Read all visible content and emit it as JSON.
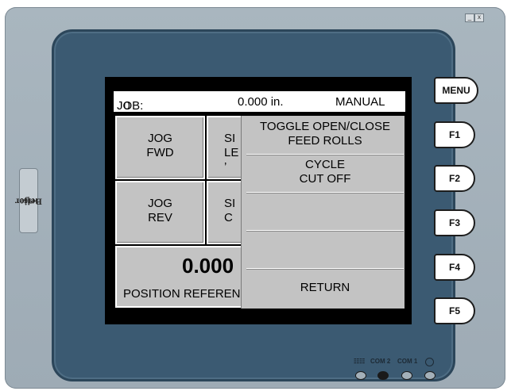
{
  "window_controls": {
    "minimize": "_",
    "close": "x"
  },
  "brand": {
    "model": "HT60",
    "separator": "|",
    "name": "Beijer"
  },
  "status": {
    "job_label": "JOB:",
    "job_value": "0",
    "position": "0.000 in.",
    "mode": "MANUAL"
  },
  "tiles": {
    "jog_fwd": [
      "JOG",
      "FWD"
    ],
    "sil1": [
      "SI",
      "LE",
      "’"
    ],
    "jog_rev": [
      "JOG",
      "REV"
    ],
    "sil2": [
      "SI",
      "C"
    ]
  },
  "position_box": {
    "value": "0.000",
    "label": "POSITION REFERENCE"
  },
  "popup_menu": {
    "items": [
      {
        "line1": "TOGGLE OPEN/CLOSE",
        "line2": "FEED ROLLS"
      },
      {
        "line1": "CYCLE",
        "line2": "CUT OFF"
      },
      {
        "line1": "",
        "line2": ""
      },
      {
        "line1": "",
        "line2": ""
      },
      {
        "line1": "RETURN",
        "line2": ""
      }
    ]
  },
  "function_keys": {
    "menu": "MENU",
    "f1": "F1",
    "f2": "F2",
    "f3": "F3",
    "f4": "F4",
    "f5": "F5"
  },
  "ports": {
    "network": "22",
    "com2": "COM 2",
    "com1": "COM 1"
  }
}
